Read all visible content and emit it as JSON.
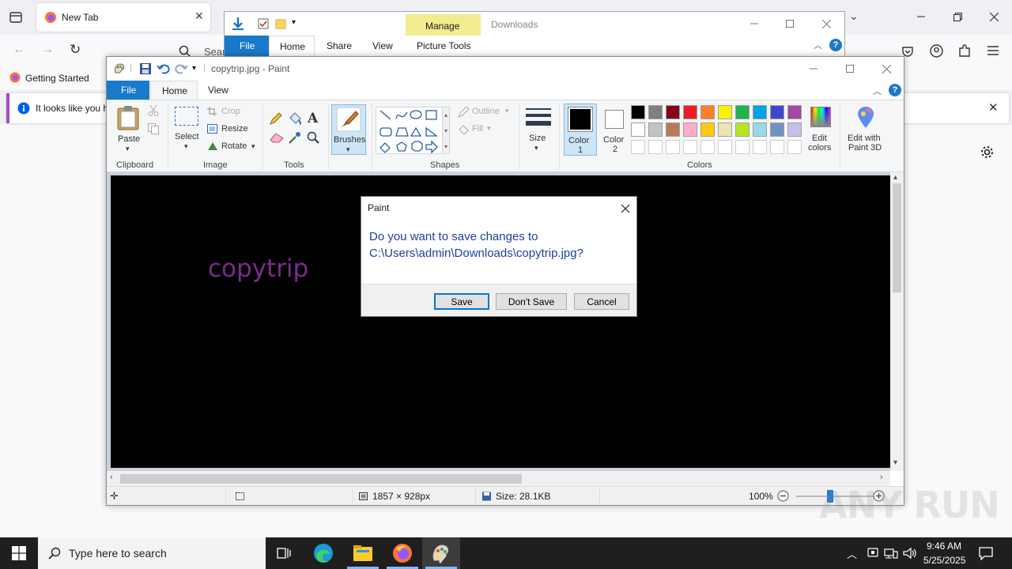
{
  "firefox": {
    "tab_title": "New Tab",
    "search_fragment": "Sear",
    "bookmark": "Getting Started",
    "notice_text": "It looks like you h"
  },
  "explorer": {
    "manage": "Manage",
    "downloads": "Downloads",
    "tabs": [
      "File",
      "Home",
      "Share",
      "View",
      "Picture Tools"
    ],
    "help": "?"
  },
  "paint": {
    "title": "copytrip.jpg - Paint",
    "tabs": [
      "File",
      "Home",
      "View"
    ],
    "help": "?",
    "clipboard": {
      "paste": "Paste",
      "label": "Clipboard"
    },
    "image": {
      "select": "Select",
      "crop": "Crop",
      "resize": "Resize",
      "rotate": "Rotate",
      "label": "Image"
    },
    "tools": {
      "label": "Tools"
    },
    "brushes": "Brushes",
    "shapes": {
      "outline": "Outline",
      "fill": "Fill",
      "label": "Shapes"
    },
    "size": "Size",
    "color1": [
      "Color",
      "1"
    ],
    "color2": [
      "Color",
      "2"
    ],
    "colors_label": "Colors",
    "edit_colors": [
      "Edit",
      "colors"
    ],
    "edit_paint3d": [
      "Edit with",
      "Paint 3D"
    ],
    "palette_row1": [
      "#000000",
      "#7f7f7f",
      "#880015",
      "#ed1c24",
      "#ff7f27",
      "#fff200",
      "#22b14c",
      "#00a2e8",
      "#3f48cc",
      "#a349a4"
    ],
    "palette_row2": [
      "#ffffff",
      "#c3c3c3",
      "#b97a57",
      "#ffaec9",
      "#ffc90e",
      "#efe4b0",
      "#b5e61d",
      "#99d9ea",
      "#7092be",
      "#c8bfe7"
    ],
    "canvas_text": "copytrip",
    "canvas_text_color": "#7d2b8c",
    "status": {
      "dimensions": "1857 × 928px",
      "size": "Size: 28.1KB",
      "zoom": "100%"
    }
  },
  "dialog": {
    "title": "Paint",
    "message_line1": "Do you want to save changes to",
    "message_line2": "C:\\Users\\admin\\Downloads\\copytrip.jpg?",
    "save": "Save",
    "dont_save": "Don't Save",
    "cancel": "Cancel"
  },
  "taskbar": {
    "search_placeholder": "Type here to search",
    "time": "9:46 AM",
    "date": "5/25/2025"
  },
  "watermark": "ANY RUN"
}
